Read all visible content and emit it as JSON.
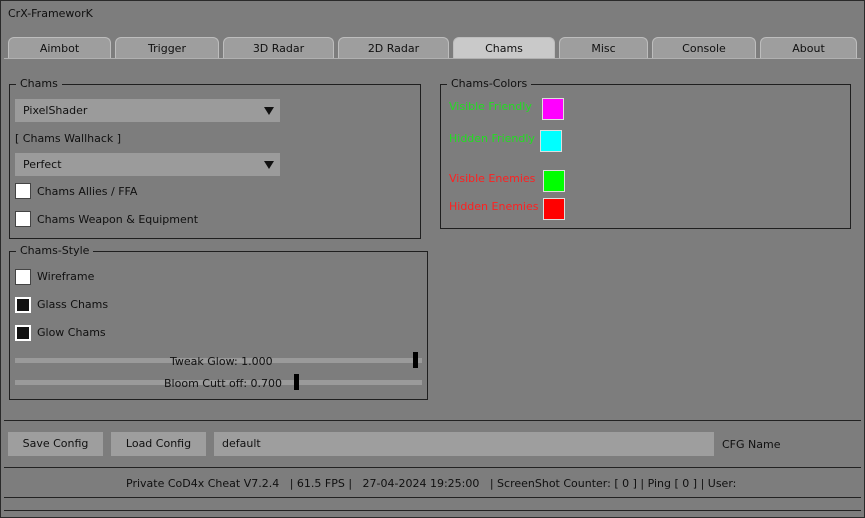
{
  "app": {
    "title": "CrX-FrameworK"
  },
  "tabs": [
    {
      "label": "Aimbot"
    },
    {
      "label": "Trigger"
    },
    {
      "label": "3D Radar"
    },
    {
      "label": "2D Radar"
    },
    {
      "label": "Chams"
    },
    {
      "label": "Misc"
    },
    {
      "label": "Console"
    },
    {
      "label": "About"
    }
  ],
  "active_tab": "Chams",
  "chams": {
    "group_title": "Chams",
    "mode_select": "PixelShader",
    "wallhack_label": "[ Chams Wallhack ]",
    "wallhack_select": "Perfect",
    "allies_ffa": {
      "label": "Chams Allies / FFA",
      "checked": false
    },
    "weapon_equipment": {
      "label": "Chams Weapon & Equipment",
      "checked": false
    }
  },
  "chams_style": {
    "group_title": "Chams-Style",
    "wireframe": {
      "label": "Wireframe",
      "checked": false
    },
    "glass": {
      "label": "Glass Chams",
      "checked": true
    },
    "glow": {
      "label": "Glow Chams",
      "checked": true
    },
    "tweak_glow": {
      "label": "Tweak Glow: 1.000",
      "value": 1.0,
      "fraction": 1.0
    },
    "bloom_cutoff": {
      "label": "Bloom Cutt off: 0.700",
      "value": 0.7,
      "fraction": 0.7
    }
  },
  "chams_colors": {
    "group_title": "Chams-Colors",
    "visible_friendly": {
      "label": "Visible Friendly",
      "text_color": "#22dd22",
      "swatch": "#ff00ff"
    },
    "hidden_friendly": {
      "label": "Hidden Friendly",
      "text_color": "#22dd22",
      "swatch": "#00ffff"
    },
    "visible_enemies": {
      "label": "Visible Enemies",
      "text_color": "#ff2020",
      "swatch": "#00ff00"
    },
    "hidden_enemies": {
      "label": "Hidden Enemies",
      "text_color": "#ff2020",
      "swatch": "#ff0000"
    }
  },
  "config": {
    "save_label": "Save Config",
    "load_label": "Load Config",
    "name_value": "default",
    "name_label": "CFG Name"
  },
  "status": {
    "text": "Private CoD4x Cheat V7.2.4   | 61.5 FPS |   27-04-2024 19:25:00   | ScreenShot Counter: [ 0 ] | Ping [ 0 ] | User:"
  }
}
